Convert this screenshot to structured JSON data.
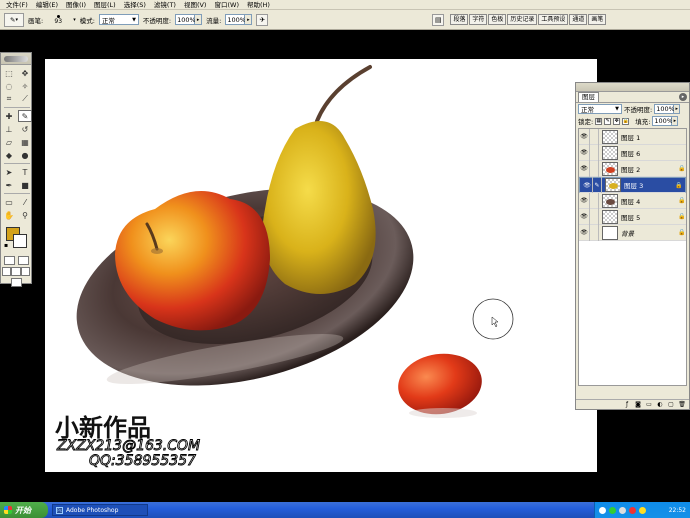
{
  "menu": [
    "文件(F)",
    "编辑(E)",
    "图像(I)",
    "图层(L)",
    "选择(S)",
    "滤镜(T)",
    "视图(V)",
    "窗口(W)",
    "帮助(H)"
  ],
  "options": {
    "brush_label": "画笔:",
    "brush_size": "93",
    "mode_label": "模式:",
    "mode_value": "正常",
    "opacity_label": "不透明度:",
    "opacity_value": "100%",
    "flow_label": "流量:",
    "flow_value": "100%"
  },
  "palette_well": [
    "段落",
    "字符",
    "色板",
    "历史记录",
    "工具预设",
    "通道",
    "画笔"
  ],
  "canvas": {
    "watermark_title": "小新作品",
    "watermark_email": "ZXZX213@163.COM",
    "watermark_qq": "QQ:358955357"
  },
  "layers_panel": {
    "tab": "图层",
    "mode": "正常",
    "opacity_label": "不透明度:",
    "opacity_value": "100%",
    "lock_label": "锁定:",
    "fill_label": "填充:",
    "fill_value": "100%",
    "layers": [
      {
        "name": "图层 1",
        "selected": false,
        "locked": false,
        "thumb": "none"
      },
      {
        "name": "图层 6",
        "selected": false,
        "locked": false,
        "thumb": "none"
      },
      {
        "name": "图层 2",
        "selected": false,
        "locked": true,
        "thumb": "#d04020"
      },
      {
        "name": "图层 3",
        "selected": true,
        "locked": true,
        "thumb": "#d8b020"
      },
      {
        "name": "图层 4",
        "selected": false,
        "locked": true,
        "thumb": "#6a4a40"
      },
      {
        "name": "图层 5",
        "selected": false,
        "locked": true,
        "thumb": "none"
      },
      {
        "name": "背景",
        "selected": false,
        "locked": true,
        "thumb": "plain"
      }
    ]
  },
  "taskbar": {
    "start": "开始",
    "task_label": "Adobe Photoshop",
    "clock": "22:52"
  },
  "colors": {
    "foreground": "#d4a21a",
    "background": "#ffffff",
    "selection": "#2a4da3"
  }
}
